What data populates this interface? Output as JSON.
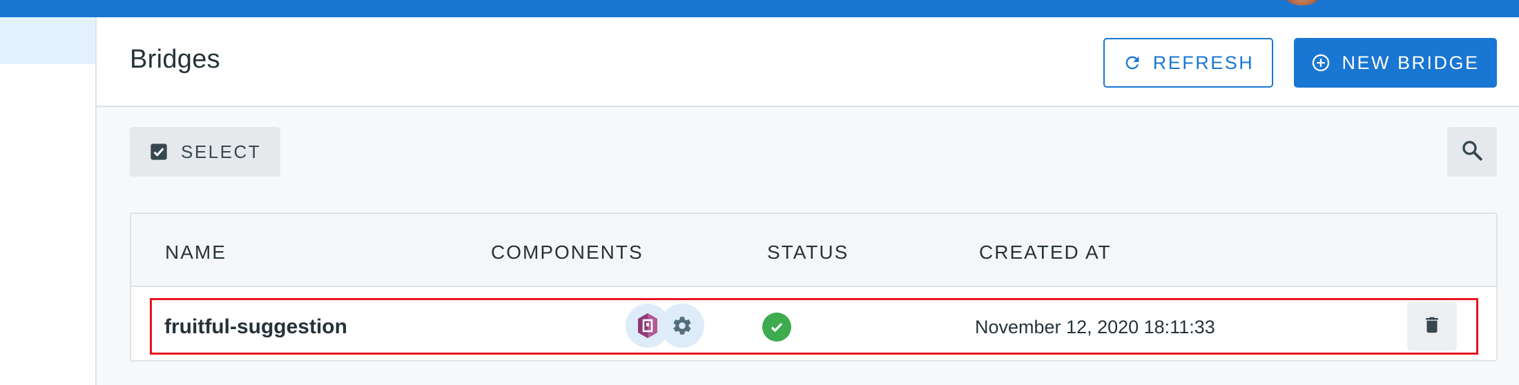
{
  "colors": {
    "primary": "#1976d2",
    "success": "#3dab4e",
    "highlight": "#e8131f"
  },
  "header": {
    "title": "Bridges",
    "refresh_label": "REFRESH",
    "refresh_icon": "refresh-icon",
    "new_label": "NEW BRIDGE",
    "new_icon": "add-circle-icon"
  },
  "toolbar": {
    "select_label": "SELECT",
    "select_icon": "checkbox-checked-icon",
    "search_icon": "search-icon"
  },
  "table": {
    "columns": [
      "NAME",
      "COMPONENTS",
      "STATUS",
      "CREATED AT"
    ],
    "rows": [
      {
        "name": "fruitful-suggestion",
        "components": [
          "connector-logo-icon",
          "gear-icon"
        ],
        "status": "ready",
        "status_icon": "check-circle-icon",
        "created_at": "November 12, 2020 18:11:33",
        "action_icon": "trash-icon"
      }
    ]
  }
}
